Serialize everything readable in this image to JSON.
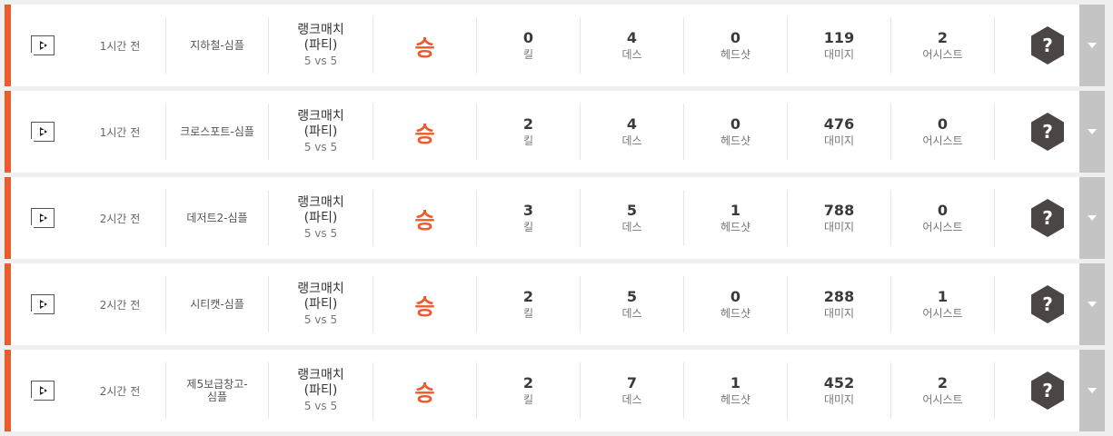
{
  "colors": {
    "accent": "#ee5a2b",
    "tier_hex": "#4b4543"
  },
  "labels": {
    "kill": "킬",
    "death": "데스",
    "headshot": "헤드샷",
    "damage": "대미지",
    "assist": "어시스트"
  },
  "matches": [
    {
      "time": "1시간 전",
      "map": "지하철-심플",
      "mode": "랭크매치\n(파티)",
      "mode_sub": "5 vs 5",
      "result": "승",
      "kills": "0",
      "deaths": "4",
      "headshots": "0",
      "damage": "119",
      "assists": "2",
      "tier": "?"
    },
    {
      "time": "1시간 전",
      "map": "크로스포트-심플",
      "mode": "랭크매치\n(파티)",
      "mode_sub": "5 vs 5",
      "result": "승",
      "kills": "2",
      "deaths": "4",
      "headshots": "0",
      "damage": "476",
      "assists": "0",
      "tier": "?"
    },
    {
      "time": "2시간 전",
      "map": "데저트2-심플",
      "mode": "랭크매치\n(파티)",
      "mode_sub": "5 vs 5",
      "result": "승",
      "kills": "3",
      "deaths": "5",
      "headshots": "1",
      "damage": "788",
      "assists": "0",
      "tier": "?"
    },
    {
      "time": "2시간 전",
      "map": "시티캣-심플",
      "mode": "랭크매치\n(파티)",
      "mode_sub": "5 vs 5",
      "result": "승",
      "kills": "2",
      "deaths": "5",
      "headshots": "0",
      "damage": "288",
      "assists": "1",
      "tier": "?"
    },
    {
      "time": "2시간 전",
      "map": "제5보급창고-\n심플",
      "mode": "랭크매치\n(파티)",
      "mode_sub": "5 vs 5",
      "result": "승",
      "kills": "2",
      "deaths": "7",
      "headshots": "1",
      "damage": "452",
      "assists": "2",
      "tier": "?"
    }
  ]
}
